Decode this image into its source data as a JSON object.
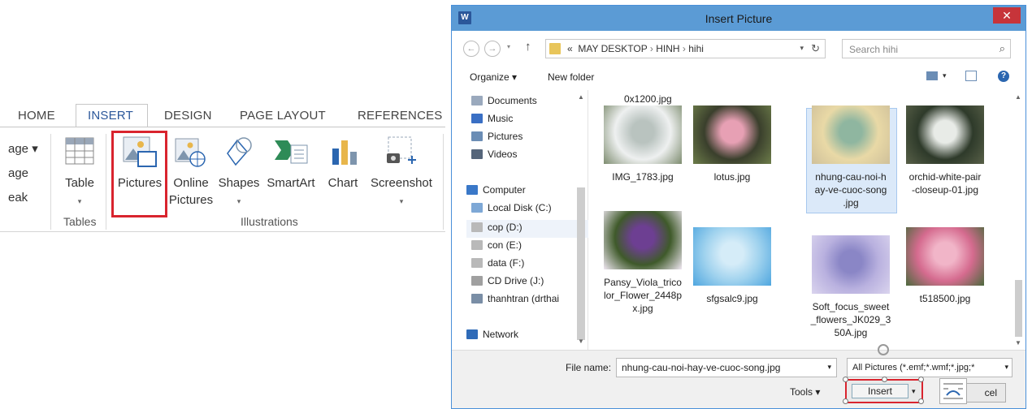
{
  "ribbon": {
    "tabs": [
      {
        "label": "HOME"
      },
      {
        "label": "INSERT"
      },
      {
        "label": "DESIGN"
      },
      {
        "label": "PAGE LAYOUT"
      },
      {
        "label": "REFERENCES"
      }
    ],
    "partial_labels": [
      "age ▾",
      "age",
      "eak"
    ],
    "buttons": {
      "table": "Table",
      "pictures": "Pictures",
      "online_1": "Online",
      "online_2": "Pictures",
      "shapes": "Shapes",
      "smartart": "SmartArt",
      "chart": "Chart",
      "screenshot": "Screenshot"
    },
    "groups": {
      "tables": "Tables",
      "illustrations": "Illustrations"
    }
  },
  "dialog": {
    "title": "Insert Picture",
    "app_icon": "W",
    "close": "✕",
    "address": {
      "prefix": "«",
      "crumbs": [
        "MAY DESKTOP",
        "HINH",
        "hihi"
      ],
      "sep": "›"
    },
    "search_placeholder": "Search hihi",
    "toolbar": {
      "organize": "Organize ▾",
      "new_folder": "New folder"
    },
    "nav": [
      {
        "label": "Documents",
        "color": "#9aa9bd"
      },
      {
        "label": "Music",
        "color": "#3a6fc4"
      },
      {
        "label": "Pictures",
        "color": "#6b8db5"
      },
      {
        "label": "Videos",
        "color": "#55657a"
      },
      {
        "label": "Computer",
        "color": "#3a78c8"
      },
      {
        "label": "Local Disk (C:)",
        "color": "#7ea8d6"
      },
      {
        "label": "cop (D:)",
        "color": "#b9b9b9"
      },
      {
        "label": "con (E:)",
        "color": "#b9b9b9"
      },
      {
        "label": "data (F:)",
        "color": "#b9b9b9"
      },
      {
        "label": "CD Drive (J:)",
        "color": "#a0a0a0"
      },
      {
        "label": "thanhtran (drthai",
        "color": "#7a8ea6"
      },
      {
        "label": "Network",
        "color": "#2f6bb8"
      }
    ],
    "top_partial_label": "0x1200.jpg",
    "files": [
      {
        "name_lines": [
          "IMG_1783.jpg"
        ],
        "colors": [
          "#eef0f0",
          "#b9c3bf",
          "#7d8c6f"
        ]
      },
      {
        "name_lines": [
          "lotus.jpg"
        ],
        "colors": [
          "#3a3f2c",
          "#e7a0b4",
          "#6d7d4a"
        ]
      },
      {
        "name_lines": [
          "nhung-cau-noi-h",
          "ay-ve-cuoc-song",
          ".jpg"
        ],
        "colors": [
          "#e9d9a6",
          "#8fb6a0",
          "#cfc09a"
        ]
      },
      {
        "name_lines": [
          "orchid-white-pair",
          "-closeup-01.jpg"
        ],
        "colors": [
          "#2e3a2a",
          "#e8ebe7",
          "#586048"
        ]
      },
      {
        "name_lines": [
          "Pansy_Viola_trico",
          "lor_Flower_2448p",
          "x.jpg"
        ],
        "colors": [
          "#3f5a2a",
          "#6d3f92",
          "#f0e8f3"
        ]
      },
      {
        "name_lines": [
          "sfgsalc9.jpg"
        ],
        "colors": [
          "#9fd2ee",
          "#d5ecf8",
          "#4fa6df"
        ]
      },
      {
        "name_lines": [
          "Soft_focus_sweet",
          "_flowers_JK029_3",
          "50A.jpg"
        ],
        "colors": [
          "#b9b1df",
          "#8a86c6",
          "#dad4ee"
        ]
      },
      {
        "name_lines": [
          "t518500.jpg"
        ],
        "colors": [
          "#d56b8f",
          "#f1b5c8",
          "#4c6a3d"
        ]
      }
    ],
    "file_name_label": "File name:",
    "file_name_value": "nhung-cau-noi-hay-ve-cuoc-song.jpg",
    "file_type": "All Pictures (*.emf;*.wmf;*.jpg;*",
    "tools": "Tools ▾",
    "insert": "Insert",
    "cancel": "cel"
  }
}
